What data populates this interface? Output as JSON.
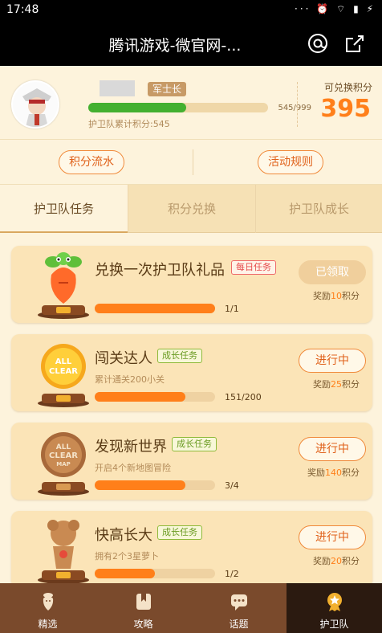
{
  "status_bar": {
    "time": "17:48",
    "icons": "··· ⏰ ⌔ ▮ ⚡"
  },
  "header": {
    "title": "腾讯游戏-微官网-..."
  },
  "profile": {
    "rank": "军士长",
    "xp_current": 545,
    "xp_max": 999,
    "xp_text": "545/999",
    "total_label": "护卫队累计积分:545",
    "points_label": "可兑换积分",
    "points_value": "395"
  },
  "actions": {
    "flow": "积分流水",
    "rules": "活动规则"
  },
  "tabs": [
    {
      "label": "护卫队任务",
      "active": true
    },
    {
      "label": "积分兑换",
      "active": false
    },
    {
      "label": "护卫队成长",
      "active": false
    }
  ],
  "tasks": [
    {
      "title": "兑换一次护卫队礼品",
      "badge": "每日任务",
      "badge_type": "daily",
      "desc": "",
      "progress_text": "1/1",
      "progress": 1.0,
      "status": "已领取",
      "status_type": "done",
      "reward_prefix": "奖励",
      "reward_num": "10",
      "reward_suffix": "积分",
      "trophy": "carrot"
    },
    {
      "title": "闯关达人",
      "badge": "成长任务",
      "badge_type": "growth",
      "desc": "累计通关200小关",
      "progress_text": "151/200",
      "progress": 0.755,
      "status": "进行中",
      "status_type": "doing",
      "reward_prefix": "奖励",
      "reward_num": "25",
      "reward_suffix": "积分",
      "trophy": "gold-medal"
    },
    {
      "title": "发现新世界",
      "badge": "成长任务",
      "badge_type": "growth",
      "desc": "开启4个新地图冒险",
      "progress_text": "3/4",
      "progress": 0.75,
      "status": "进行中",
      "status_type": "doing",
      "reward_prefix": "奖励",
      "reward_num": "140",
      "reward_suffix": "积分",
      "trophy": "bronze-medal"
    },
    {
      "title": "快高长大",
      "badge": "成长任务",
      "badge_type": "growth",
      "desc": "拥有2个3星萝卜",
      "progress_text": "1/2",
      "progress": 0.5,
      "status": "进行中",
      "status_type": "doing",
      "reward_prefix": "奖励",
      "reward_num": "20",
      "reward_suffix": "积分",
      "trophy": "bronze-figure"
    }
  ],
  "bottom_nav": [
    {
      "label": "精选",
      "icon": "carrot-icon",
      "active": false
    },
    {
      "label": "攻略",
      "icon": "bookmark-icon",
      "active": false
    },
    {
      "label": "话题",
      "icon": "chat-icon",
      "active": false
    },
    {
      "label": "护卫队",
      "icon": "badge-icon",
      "active": true
    }
  ],
  "colors": {
    "accent": "#ff7f1a",
    "progress_green": "#43b030",
    "nav_bg": "#7a4a2c"
  }
}
